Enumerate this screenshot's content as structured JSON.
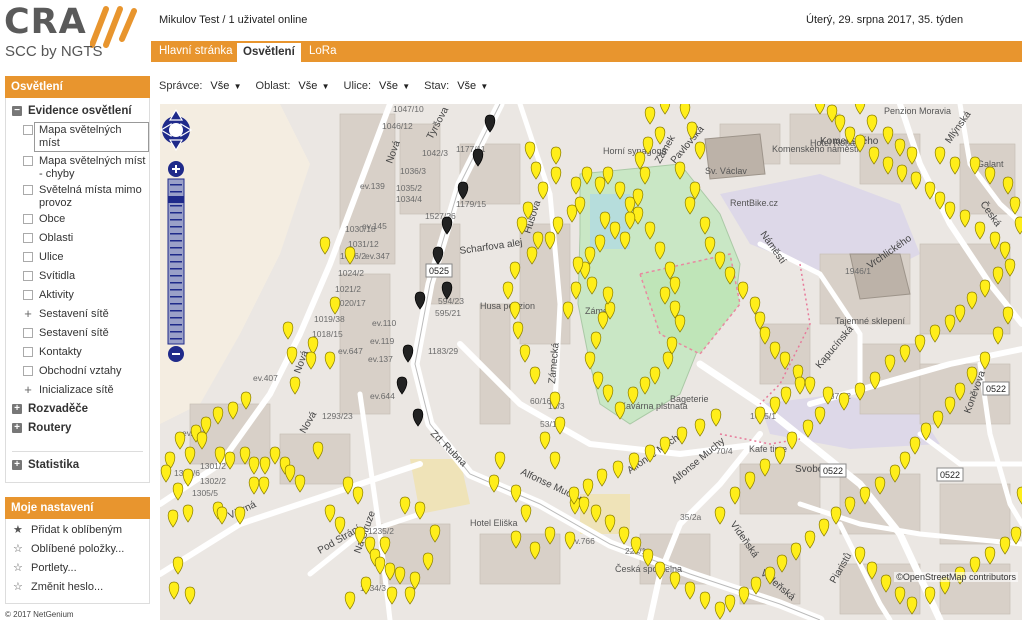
{
  "header": {
    "logo_text": "CRA",
    "logo_sub": "SCC by NGTS",
    "user": "Mikulov Test / 1 uživatel online",
    "date": "Úterý, 29. srpna 2017, 35. týden"
  },
  "tabs": [
    {
      "label": "Hlavní stránka",
      "active": false
    },
    {
      "label": "Osvětlení",
      "active": true
    },
    {
      "label": "LoRa",
      "active": false
    }
  ],
  "sidebar": {
    "title": "Osvětlení",
    "group": "Evidence osvětlení",
    "items": [
      "Mapa světelných míst",
      "Mapa světelných míst - chyby",
      "Světelná místa mimo provoz",
      "Obce",
      "Oblasti",
      "Ulice",
      "Svítidla",
      "Aktivity",
      "Sestavení sítě",
      "Sestavení sítě",
      "Kontakty",
      "Obchodní vztahy",
      "Inicializace sítě"
    ],
    "sections": [
      "Rozvaděče",
      "Routery",
      "Statistika"
    ]
  },
  "settings": {
    "title": "Moje nastavení",
    "items": [
      "Přidat k oblíbeným",
      "Oblíbené položky...",
      "Portlety...",
      "Změnit heslo..."
    ]
  },
  "copyright": "© 2017 NetGenium",
  "filters": [
    {
      "label": "Správce:",
      "value": "Vše"
    },
    {
      "label": "Oblast:",
      "value": "Vše"
    },
    {
      "label": "Ulice:",
      "value": "Vše"
    },
    {
      "label": "Stav:",
      "value": "Vše"
    }
  ],
  "map": {
    "attribution": "©OpenStreetMap contributors",
    "streets": [
      "Tyršova",
      "Nová",
      "Nová",
      "Nová",
      "Scharfova alej",
      "Husova",
      "Zámecká",
      "Alfonse Muchy",
      "Alfonse Muchy",
      "Alfonse Muchy",
      "Větrná",
      "Pod Strání",
      "Na Struze",
      "Zd. Rubna",
      "Náměstí",
      "Kapucínská",
      "Svobody",
      "Vídeňská",
      "Vídeňská",
      "Vrchlického",
      "Česká",
      "Mlýnská",
      "Piaristů",
      "Koněvova",
      "Zámek",
      "Komenského",
      "Pavlovská"
    ],
    "labels": [
      "Horní synagoga",
      "Husa penzion",
      "Zámek",
      "Kavárna plstnatá",
      "Hotel Eliška",
      "Česká spořitelna",
      "Bageterie",
      "Tajemné sklepení",
      "Penzion Moravia",
      "Hotel Rohatý",
      "Sv. Václav",
      "Kafe time",
      "Galant",
      "RentBike.cz",
      "Komenského náměstí"
    ],
    "badges": [
      "0525",
      "0522",
      "0522",
      "0522"
    ],
    "addresses": [
      "1047/10",
      "1046/12",
      "1042/3",
      "1036/3",
      "1035/2",
      "1034/4",
      "1030/18",
      "1031/12",
      "1026/2",
      "1024/2",
      "1021/2",
      "1020/17",
      "1019/38",
      "1018/15",
      "1177/11",
      "1179/15",
      "1527/26",
      "594/23",
      "595/21",
      "1183/29",
      "1293/23",
      "1301/2",
      "1302/2",
      "1305/5",
      "1306/6",
      "1235/2",
      "1234/3",
      "1685/1",
      "1946/1",
      "187/12",
      "224/1",
      "35/2a",
      "70/4",
      "53/11",
      "60/16",
      "15/3",
      "ev.139",
      "ev.145",
      "ev.347",
      "ev.110",
      "ev.119",
      "ev.137",
      "ev.644",
      "ev.647",
      "ev.407",
      "ev.439",
      "ev.766"
    ]
  },
  "colors": {
    "accent": "#e8952e",
    "marker": "#ffee1a",
    "marker_off": "#222222",
    "zoom_control": "#1f2a8a"
  }
}
